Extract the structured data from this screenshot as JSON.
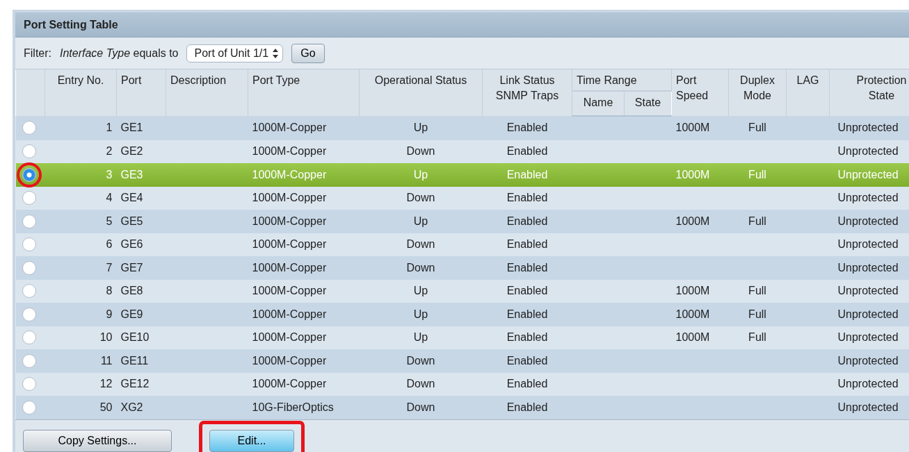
{
  "panel": {
    "title": "Port Setting Table"
  },
  "filter": {
    "label": "Filter:",
    "condition": "*Interface Type* equals to",
    "select_value": "Port of Unit 1/1",
    "go_button": "Go"
  },
  "table": {
    "columns": [
      "Entry No.",
      "Port",
      "Description",
      "Port Type",
      "Operational Status",
      "Link Status",
      "SNMP Traps",
      "Time Range",
      "Name",
      "State",
      "Port",
      "Speed",
      "Duplex",
      "Mode",
      "LAG",
      "Protection",
      "State"
    ],
    "rows": [
      {
        "entry": "1",
        "port": "GE1",
        "port_type": "1000M-Copper",
        "operational_status": "Up",
        "link_status_snmp_traps": "Enabled",
        "port_speed": "1000M",
        "duplex_mode": "Full",
        "protection_state": "Unprotected",
        "selected": false
      },
      {
        "entry": "2",
        "port": "GE2",
        "port_type": "1000M-Copper",
        "operational_status": "Down",
        "link_status_snmp_traps": "Enabled",
        "protection_state": "Unprotected",
        "selected": false
      },
      {
        "entry": "3",
        "port": "GE3",
        "port_type": "1000M-Copper",
        "operational_status": "Up",
        "link_status_snmp_traps": "Enabled",
        "port_speed": "1000M",
        "duplex_mode": "Full",
        "protection_state": "Unprotected",
        "selected": true
      },
      {
        "entry": "4",
        "port": "GE4",
        "port_type": "1000M-Copper",
        "operational_status": "Down",
        "link_status_snmp_traps": "Enabled",
        "protection_state": "Unprotected",
        "selected": false
      },
      {
        "entry": "5",
        "port": "GE5",
        "port_type": "1000M-Copper",
        "operational_status": "Up",
        "link_status_snmp_traps": "Enabled",
        "port_speed": "1000M",
        "duplex_mode": "Full",
        "protection_state": "Unprotected",
        "selected": false
      },
      {
        "entry": "6",
        "port": "GE6",
        "port_type": "1000M-Copper",
        "operational_status": "Down",
        "link_status_snmp_traps": "Enabled",
        "protection_state": "Unprotected",
        "selected": false
      },
      {
        "entry": "7",
        "port": "GE7",
        "port_type": "1000M-Copper",
        "operational_status": "Down",
        "link_status_snmp_traps": "Enabled",
        "protection_state": "Unprotected",
        "selected": false
      },
      {
        "entry": "8",
        "port": "GE8",
        "port_type": "1000M-Copper",
        "operational_status": "Up",
        "link_status_snmp_traps": "Enabled",
        "port_speed": "1000M",
        "duplex_mode": "Full",
        "protection_state": "Unprotected",
        "selected": false
      },
      {
        "entry": "9",
        "port": "GE9",
        "port_type": "1000M-Copper",
        "operational_status": "Up",
        "link_status_snmp_traps": "Enabled",
        "port_speed": "1000M",
        "duplex_mode": "Full",
        "protection_state": "Unprotected",
        "selected": false
      },
      {
        "entry": "10",
        "port": "GE10",
        "port_type": "1000M-Copper",
        "operational_status": "Up",
        "link_status_snmp_traps": "Enabled",
        "port_speed": "1000M",
        "duplex_mode": "Full",
        "protection_state": "Unprotected",
        "selected": false
      },
      {
        "entry": "11",
        "port": "GE11",
        "port_type": "1000M-Copper",
        "operational_status": "Down",
        "link_status_snmp_traps": "Enabled",
        "protection_state": "Unprotected",
        "selected": false
      },
      {
        "entry": "12",
        "port": "GE12",
        "port_type": "1000M-Copper",
        "operational_status": "Down",
        "link_status_snmp_traps": "Enabled",
        "protection_state": "Unprotected",
        "selected": false
      },
      {
        "entry": "50",
        "port": "XG2",
        "port_type": "10G-FiberOptics",
        "operational_status": "Down",
        "link_status_snmp_traps": "Enabled",
        "protection_state": "Unprotected",
        "selected": false
      }
    ]
  },
  "buttons": [
    {
      "label": "Copy Settings...",
      "kind": "plain",
      "highlighted": false
    },
    {
      "label": "Edit...",
      "kind": "primary",
      "highlighted": true
    }
  ]
}
